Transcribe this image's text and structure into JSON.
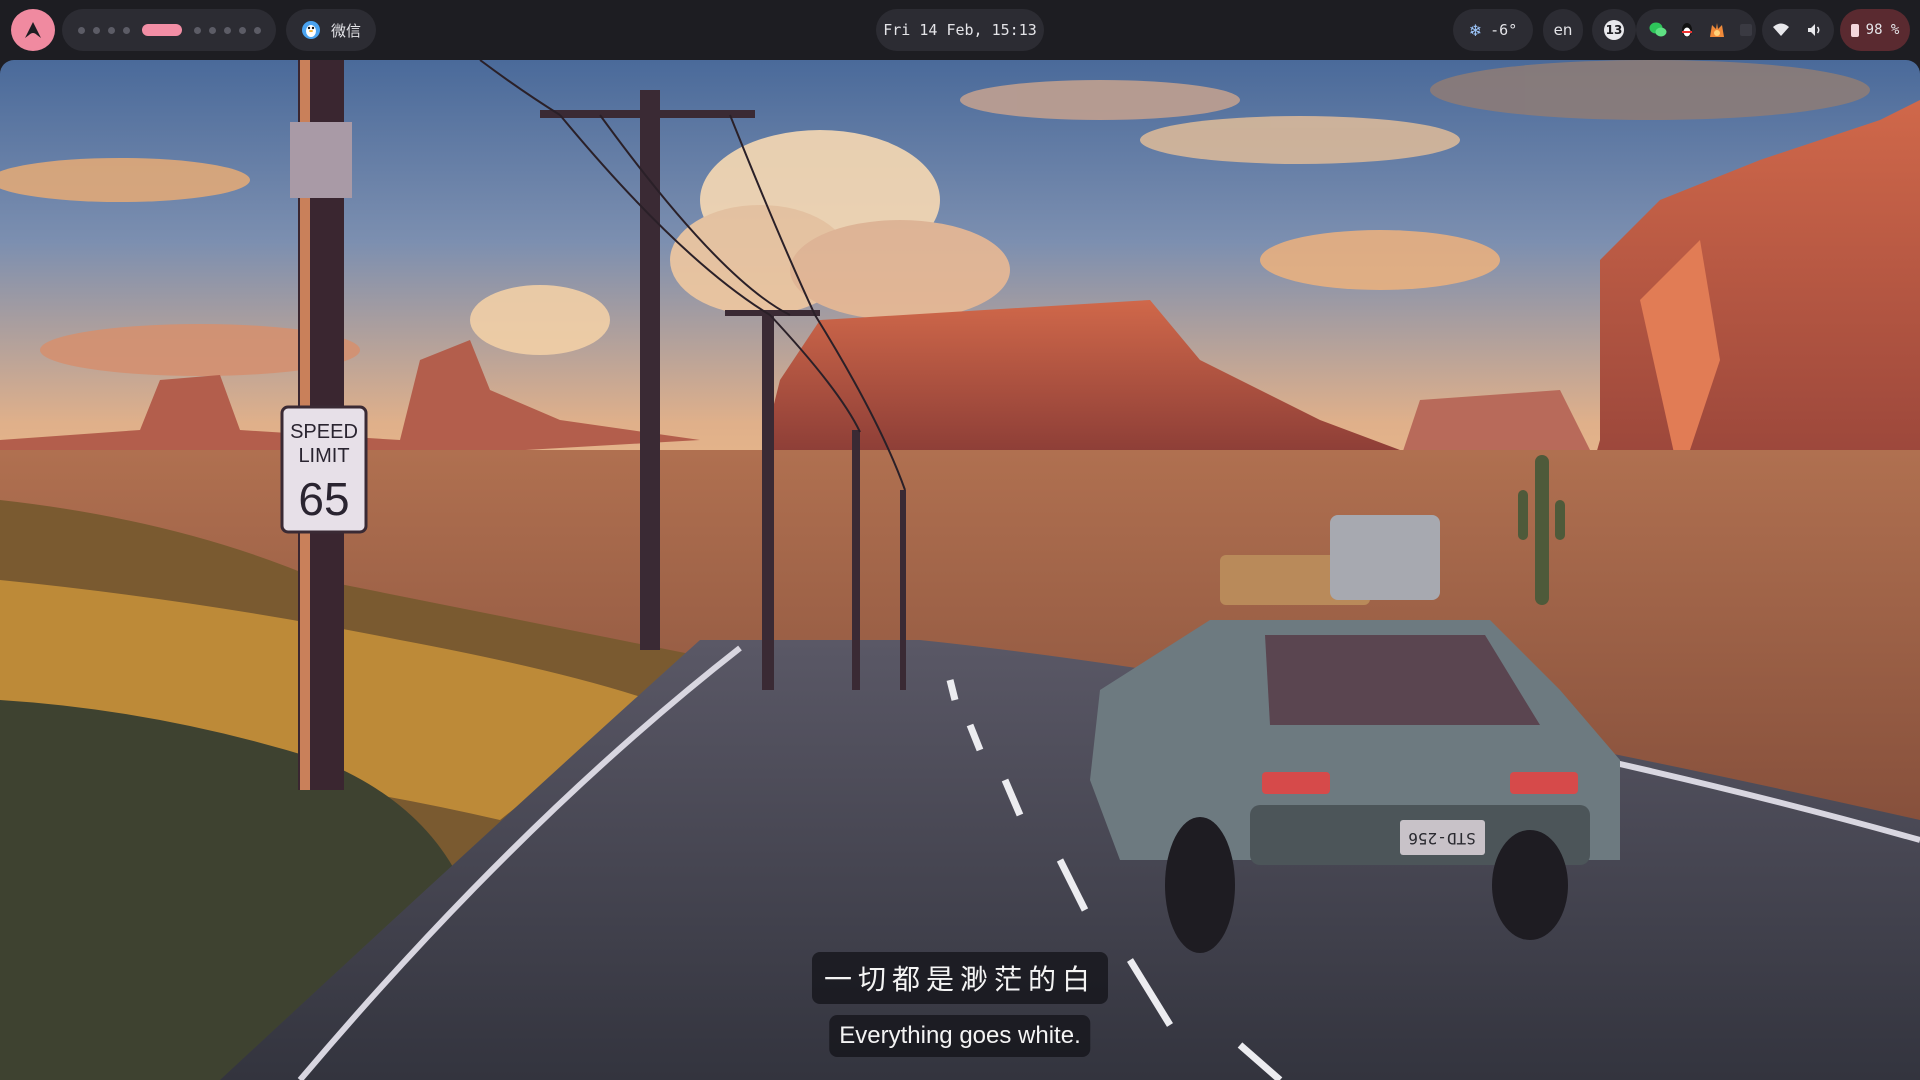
{
  "topbar": {
    "launcher_icon": "arch-logo-icon",
    "launcher_color": "#f08aa0",
    "workspaces": {
      "count": 10,
      "active_index": 4,
      "active_color": "#f28ea5"
    },
    "active_window": {
      "icon": "qq-penguin-icon",
      "label": "微信"
    },
    "clock": "Fri 14 Feb, 15:13",
    "weather": {
      "icon": "snowflake-icon",
      "temperature": "-6°"
    },
    "language": "en",
    "notifications": {
      "count": "13"
    },
    "tray_icons": [
      "wechat-icon",
      "qq-icon",
      "fcitx-icon",
      "window-icon"
    ],
    "network_icon": "wifi-icon",
    "volume_icon": "speaker-icon",
    "battery": {
      "icon": "battery-icon",
      "text": "98 %",
      "color": "#5a2a30"
    }
  },
  "wallpaper": {
    "sign": {
      "line1": "SPEED",
      "line2": "LIMIT",
      "number": "65"
    },
    "license_plate": "STD-256"
  },
  "subtitles": {
    "chinese": "一切都是渺茫的白",
    "english": "Everything goes white."
  }
}
